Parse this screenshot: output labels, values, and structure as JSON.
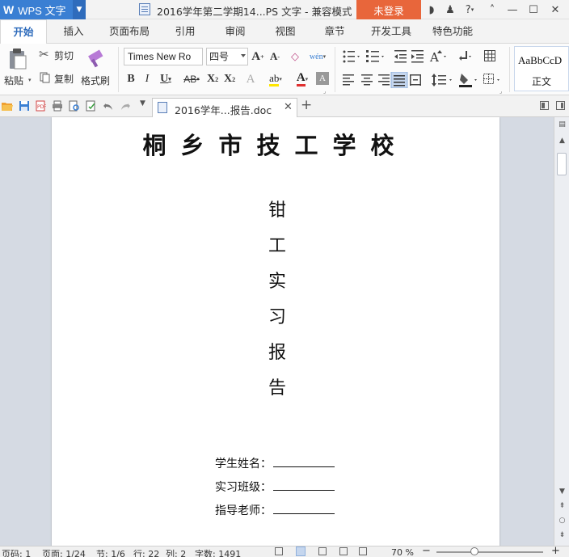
{
  "titlebar": {
    "app_name": "WPS 文字",
    "window_title": "2016学年第二学期14...PS 文字 - 兼容模式",
    "login_label": "未登录"
  },
  "menu": {
    "tabs": [
      {
        "label": "开始",
        "active": true
      },
      {
        "label": "插入"
      },
      {
        "label": "页面布局"
      },
      {
        "label": "引用"
      },
      {
        "label": "审阅"
      },
      {
        "label": "视图"
      },
      {
        "label": "章节"
      },
      {
        "label": "开发工具"
      },
      {
        "label": "特色功能"
      }
    ]
  },
  "ribbon": {
    "paste_label": "粘贴",
    "cut_label": "剪切",
    "copy_label": "复制",
    "format_painter_label": "格式刷",
    "font_name": "Times New Ro",
    "font_size": "四号",
    "style_preview": "AaBbCcD",
    "style_name": "正文"
  },
  "document_tab": {
    "label": "2016学年...报告.doc"
  },
  "document": {
    "school_name": "桐乡市技工学校",
    "title_chars": [
      "钳",
      "工",
      "实",
      "习",
      "报",
      "告"
    ],
    "fields": [
      {
        "label": "学生姓名："
      },
      {
        "label": "实习班级："
      },
      {
        "label": "指导老师："
      }
    ]
  },
  "statusbar": {
    "page_num": "页码: 1",
    "page_total": "页面: 1/24",
    "section": "节: 1/6",
    "row": "行: 22",
    "col": "列: 2",
    "word_count": "字数: 1491",
    "zoom": "70 %"
  },
  "colors": {
    "brand_blue": "#3a7fd3",
    "login_orange": "#e8663b",
    "active_tab_text": "#2f6cbc"
  }
}
